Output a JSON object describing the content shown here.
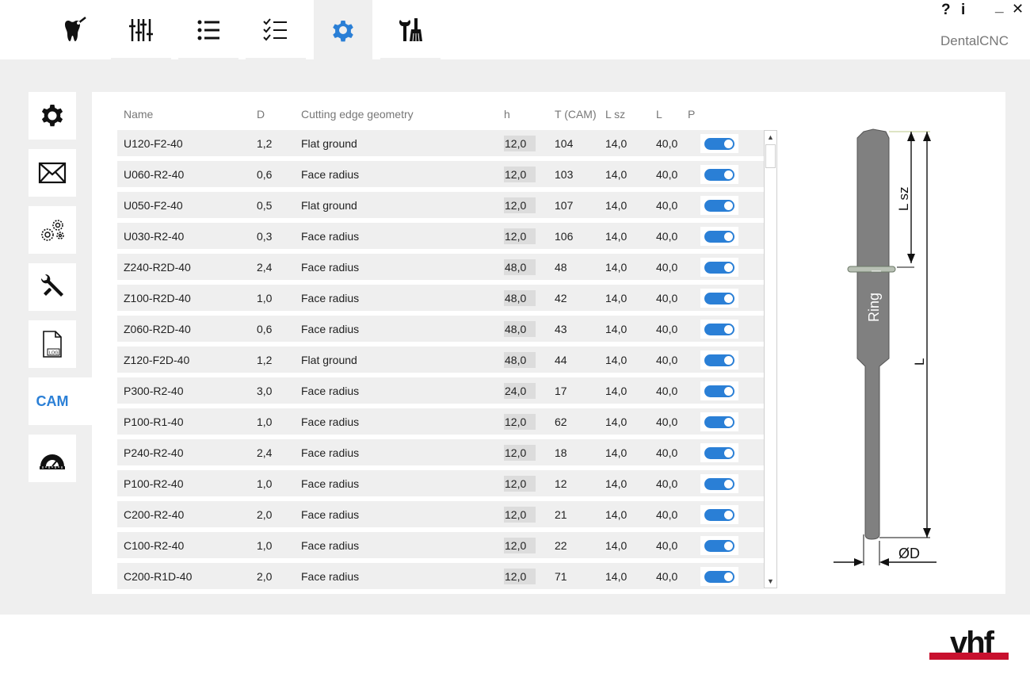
{
  "app": {
    "name": "DentalCNC"
  },
  "window_controls": {
    "help": "?",
    "info": "i",
    "minimize": "_",
    "close": "✕"
  },
  "top_tabs": [
    {
      "name": "tooth-tab",
      "icon": "tooth-drill-icon"
    },
    {
      "name": "sliders-tab",
      "icon": "sliders-icon"
    },
    {
      "name": "list-tab",
      "icon": "list-icon"
    },
    {
      "name": "checklist-tab",
      "icon": "checklist-icon"
    },
    {
      "name": "settings-tab",
      "icon": "gear-icon",
      "active": true
    },
    {
      "name": "maintenance-tab",
      "icon": "wrench-brush-icon"
    }
  ],
  "side_nav": [
    {
      "name": "general-settings",
      "icon": "gear-icon"
    },
    {
      "name": "messages",
      "icon": "envelope-icon"
    },
    {
      "name": "machine-settings",
      "icon": "gears-icon"
    },
    {
      "name": "service",
      "icon": "wrench-screwdriver-icon"
    },
    {
      "name": "log",
      "icon": "log-file-icon",
      "label": "LOG"
    },
    {
      "name": "cam",
      "label": "CAM",
      "active": true
    },
    {
      "name": "calibration",
      "icon": "protractor-icon"
    }
  ],
  "table": {
    "headers": {
      "name": "Name",
      "d": "D",
      "geometry": "Cutting edge geometry",
      "h": "h",
      "t": "T (CAM)",
      "lsz": "L sz",
      "l": "L",
      "p": "P"
    },
    "rows": [
      {
        "name": "U120-F2-40",
        "d": "1,2",
        "geometry": "Flat ground",
        "h": "12,0",
        "t": "104",
        "lsz": "14,0",
        "l": "40,0",
        "enabled": true
      },
      {
        "name": "U060-R2-40",
        "d": "0,6",
        "geometry": "Face radius",
        "h": "12,0",
        "t": "103",
        "lsz": "14,0",
        "l": "40,0",
        "enabled": true
      },
      {
        "name": "U050-F2-40",
        "d": "0,5",
        "geometry": "Flat ground",
        "h": "12,0",
        "t": "107",
        "lsz": "14,0",
        "l": "40,0",
        "enabled": true
      },
      {
        "name": "U030-R2-40",
        "d": "0,3",
        "geometry": "Face radius",
        "h": "12,0",
        "t": "106",
        "lsz": "14,0",
        "l": "40,0",
        "enabled": true
      },
      {
        "name": "Z240-R2D-40",
        "d": "2,4",
        "geometry": "Face radius",
        "h": "48,0",
        "t": "48",
        "lsz": "14,0",
        "l": "40,0",
        "enabled": true
      },
      {
        "name": "Z100-R2D-40",
        "d": "1,0",
        "geometry": "Face radius",
        "h": "48,0",
        "t": "42",
        "lsz": "14,0",
        "l": "40,0",
        "enabled": true
      },
      {
        "name": "Z060-R2D-40",
        "d": "0,6",
        "geometry": "Face radius",
        "h": "48,0",
        "t": "43",
        "lsz": "14,0",
        "l": "40,0",
        "enabled": true
      },
      {
        "name": "Z120-F2D-40",
        "d": "1,2",
        "geometry": "Flat ground",
        "h": "48,0",
        "t": "44",
        "lsz": "14,0",
        "l": "40,0",
        "enabled": true
      },
      {
        "name": "P300-R2-40",
        "d": "3,0",
        "geometry": "Face radius",
        "h": "24,0",
        "t": "17",
        "lsz": "14,0",
        "l": "40,0",
        "enabled": true
      },
      {
        "name": "P100-R1-40",
        "d": "1,0",
        "geometry": "Face radius",
        "h": "12,0",
        "t": "62",
        "lsz": "14,0",
        "l": "40,0",
        "enabled": true
      },
      {
        "name": "P240-R2-40",
        "d": "2,4",
        "geometry": "Face radius",
        "h": "12,0",
        "t": "18",
        "lsz": "14,0",
        "l": "40,0",
        "enabled": true
      },
      {
        "name": "P100-R2-40",
        "d": "1,0",
        "geometry": "Face radius",
        "h": "12,0",
        "t": "12",
        "lsz": "14,0",
        "l": "40,0",
        "enabled": true
      },
      {
        "name": "C200-R2-40",
        "d": "2,0",
        "geometry": "Face radius",
        "h": "12,0",
        "t": "21",
        "lsz": "14,0",
        "l": "40,0",
        "enabled": true
      },
      {
        "name": "C100-R2-40",
        "d": "1,0",
        "geometry": "Face radius",
        "h": "12,0",
        "t": "22",
        "lsz": "14,0",
        "l": "40,0",
        "enabled": true
      },
      {
        "name": "C200-R1D-40",
        "d": "2,0",
        "geometry": "Face radius",
        "h": "12,0",
        "t": "71",
        "lsz": "14,0",
        "l": "40,0",
        "enabled": true
      }
    ]
  },
  "drawing": {
    "ring_label": "Ring",
    "lsz_label": "L sz",
    "l_label": "L",
    "d_label": "ØD"
  },
  "brand": {
    "logo_text": "vhf",
    "accent_color": "#c8102e",
    "primary_color": "#2a7fd6"
  }
}
